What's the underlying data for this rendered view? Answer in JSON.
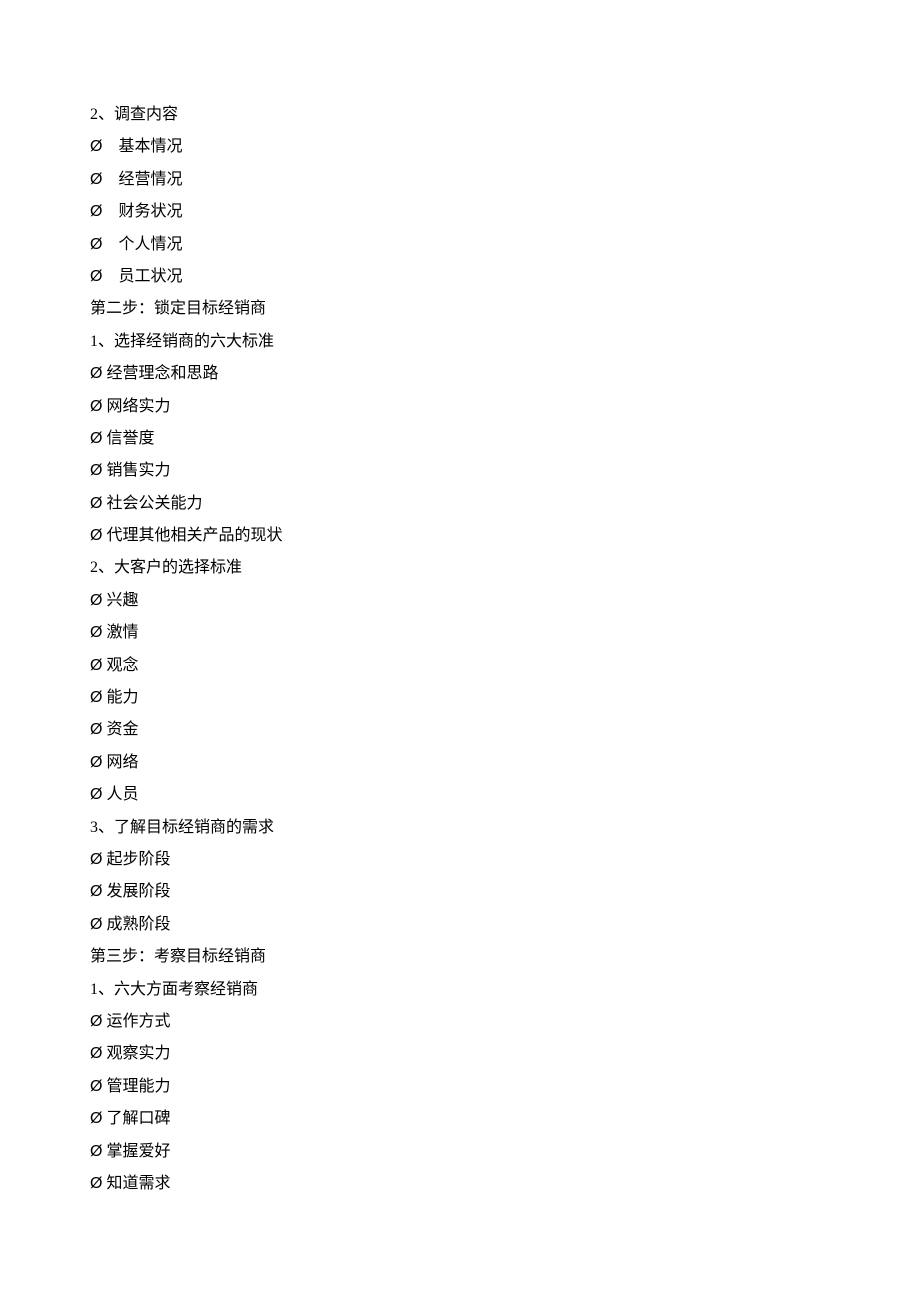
{
  "lines": [
    {
      "type": "plain",
      "text": "2、调查内容"
    },
    {
      "type": "bullet-wide",
      "text": "基本情况"
    },
    {
      "type": "bullet-wide",
      "text": "经营情况"
    },
    {
      "type": "bullet-wide",
      "text": "财务状况"
    },
    {
      "type": "bullet-wide",
      "text": "个人情况"
    },
    {
      "type": "bullet-wide",
      "text": "员工状况"
    },
    {
      "type": "plain",
      "text": "第二步：锁定目标经销商"
    },
    {
      "type": "plain",
      "text": "1、选择经销商的六大标准"
    },
    {
      "type": "bullet",
      "text": "经营理念和思路"
    },
    {
      "type": "bullet",
      "text": "网络实力"
    },
    {
      "type": "bullet",
      "text": "信誉度"
    },
    {
      "type": "bullet",
      "text": "销售实力"
    },
    {
      "type": "bullet",
      "text": "社会公关能力"
    },
    {
      "type": "bullet",
      "text": "代理其他相关产品的现状"
    },
    {
      "type": "plain",
      "text": "2、大客户的选择标准"
    },
    {
      "type": "bullet",
      "text": "兴趣"
    },
    {
      "type": "bullet",
      "text": "激情"
    },
    {
      "type": "bullet",
      "text": "观念"
    },
    {
      "type": "bullet",
      "text": "能力"
    },
    {
      "type": "bullet",
      "text": "资金"
    },
    {
      "type": "bullet",
      "text": "网络"
    },
    {
      "type": "bullet",
      "text": "人员"
    },
    {
      "type": "plain",
      "text": "3、了解目标经销商的需求"
    },
    {
      "type": "bullet",
      "text": "起步阶段"
    },
    {
      "type": "bullet",
      "text": "发展阶段"
    },
    {
      "type": "bullet",
      "text": "成熟阶段"
    },
    {
      "type": "plain",
      "text": "第三步：考察目标经销商"
    },
    {
      "type": "plain",
      "text": "1、六大方面考察经销商"
    },
    {
      "type": "bullet",
      "text": "运作方式"
    },
    {
      "type": "bullet",
      "text": "观察实力"
    },
    {
      "type": "bullet",
      "text": "管理能力"
    },
    {
      "type": "bullet",
      "text": "了解口碑"
    },
    {
      "type": "bullet",
      "text": "掌握爱好"
    },
    {
      "type": "bullet",
      "text": "知道需求"
    }
  ],
  "bullet_symbol": "Ø"
}
